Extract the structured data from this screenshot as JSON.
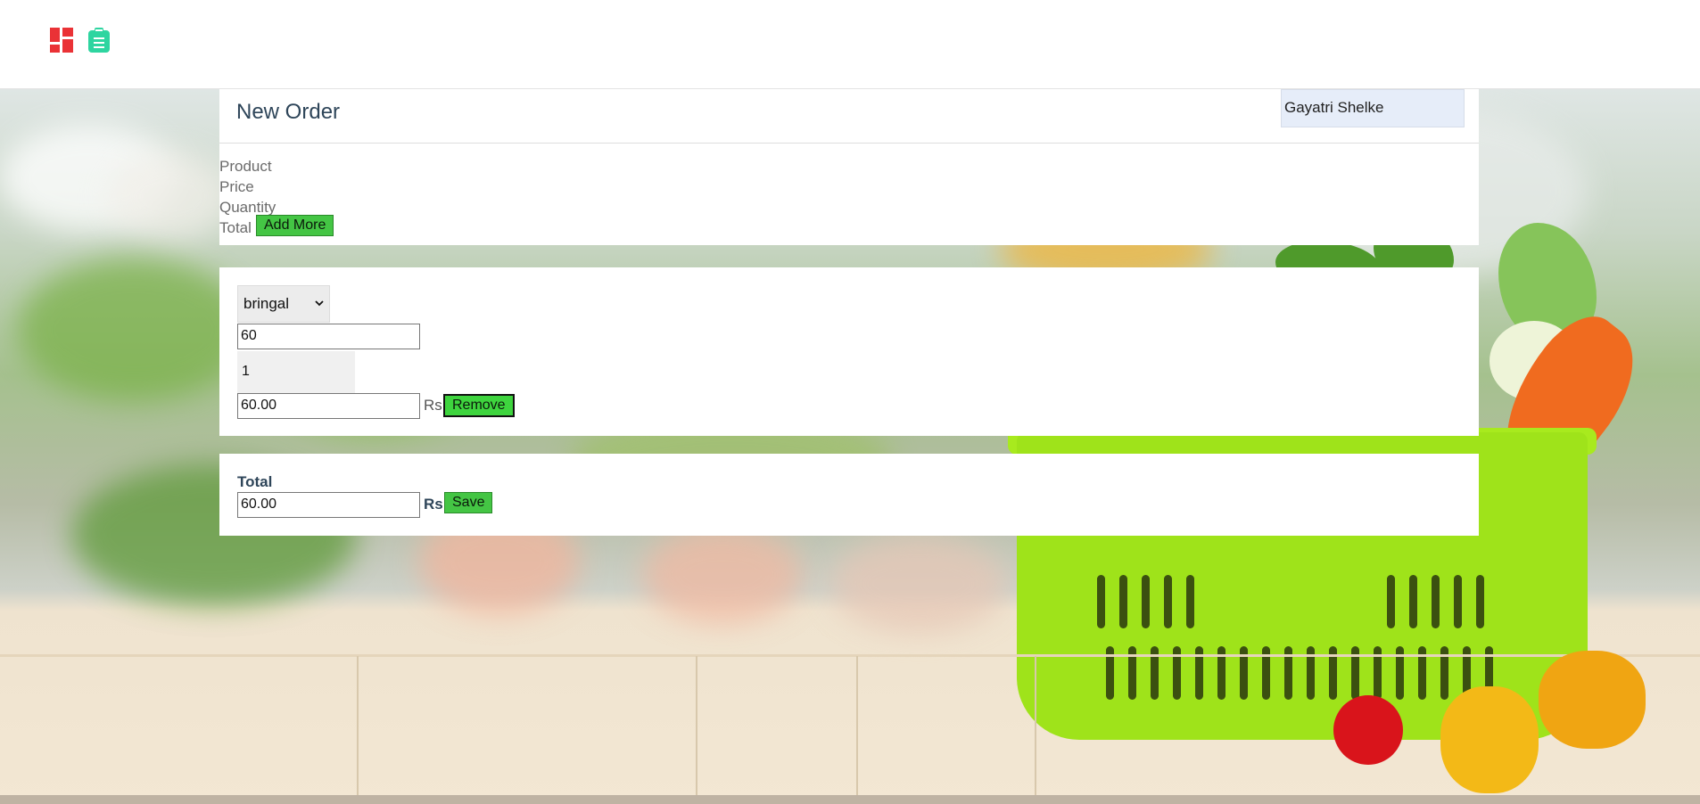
{
  "nav": {
    "icons": [
      "dashboard-icon",
      "clipboard-icon"
    ],
    "accent_dashboard": "#ea3236",
    "accent_clipboard": "#2ed5a0"
  },
  "order": {
    "title": "New Order",
    "customer_name": "Gayatri Shelke",
    "columns": {
      "product": "Product",
      "price": "Price",
      "quantity": "Quantity",
      "total": "Total"
    },
    "add_more_label": "Add More"
  },
  "item": {
    "product_selected": "bringal",
    "price_value": "60",
    "quantity_value": "1",
    "line_total_value": "60.00",
    "currency": "Rs",
    "remove_label": "Remove"
  },
  "summary": {
    "total_label": "Total",
    "total_value": "60.00",
    "currency": "Rs",
    "save_label": "Save"
  },
  "colors": {
    "button_green": "#44c544",
    "title_color": "#2e4559"
  }
}
